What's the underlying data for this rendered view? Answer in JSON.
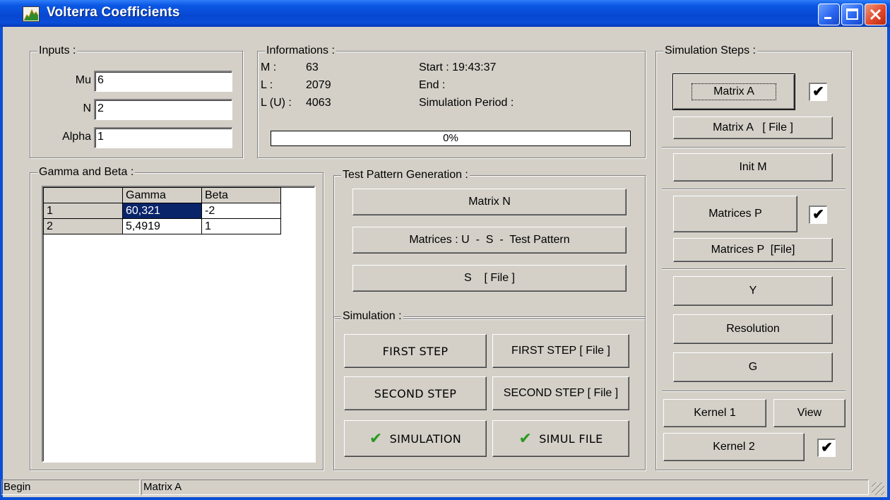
{
  "window": {
    "title": "Volterra Coefficients"
  },
  "inputs": {
    "legend": "Inputs :",
    "mu_label": "Mu",
    "mu_value": "6",
    "n_label": "N",
    "n_value": "2",
    "alpha_label": "Alpha",
    "alpha_value": "1"
  },
  "info": {
    "legend": "Informations :",
    "m_label": "M :",
    "m_value": "63",
    "l_label": "L :",
    "l_value": "2079",
    "lu_label": "L (U) :",
    "lu_value": "4063",
    "start": "Start : 19:43:37",
    "end": "End :",
    "period": "Simulation Period :",
    "progress_text": "0%",
    "progress_value": 0
  },
  "gamma_beta": {
    "legend": "Gamma and Beta :",
    "headers": [
      "",
      "Gamma",
      "Beta"
    ],
    "rows": [
      [
        "1",
        "60,321",
        "-2"
      ],
      [
        "2",
        "5,4919",
        "1"
      ]
    ]
  },
  "test_pattern": {
    "legend": "Test Pattern Generation :",
    "matrix_n": "Matrix N",
    "matrices_usp": "Matrices : U  -  S  -  Test Pattern",
    "s_file": "S    [ File ]"
  },
  "simulation": {
    "legend": "Simulation :",
    "first_step": "FIRST STEP",
    "first_step_file": "FIRST STEP [ File ]",
    "second_step": "SECOND STEP",
    "second_step_file": "SECOND STEP [ File ]",
    "simulation": "SIMULATION",
    "simul_file": "SIMUL FILE",
    "check_icon_color": "#2a9a1e"
  },
  "steps": {
    "legend": "Simulation Steps :",
    "matrix_a": "Matrix A",
    "matrix_a_file": "Matrix A   [ File ]",
    "init_m": "Init M",
    "matrices_p": "Matrices P",
    "matrices_p_file": "Matrices P  [File]",
    "y": "Y",
    "resolution": "Resolution",
    "g": "G",
    "kernel1": "Kernel 1",
    "view": "View",
    "kernel2": "Kernel 2",
    "matrix_a_checked": true,
    "matrices_p_checked": true,
    "kernel2_checked": true,
    "check_mark": "✔"
  },
  "statusbar": {
    "panel1": "Begin",
    "panel2": "Matrix A"
  }
}
